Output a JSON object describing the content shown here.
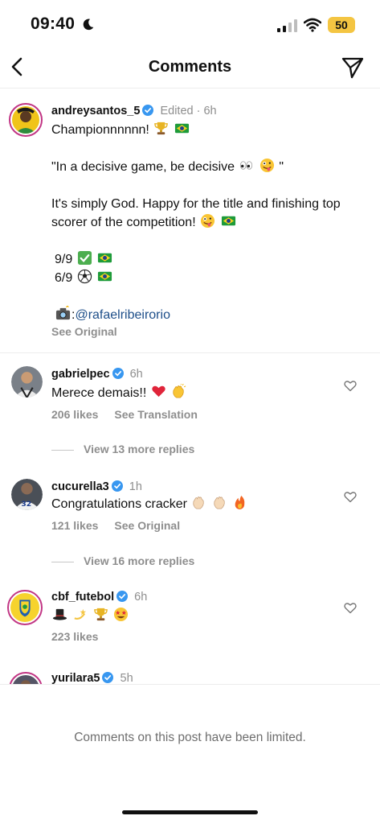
{
  "status_bar": {
    "time": "09:40",
    "battery": "50"
  },
  "header": {
    "title": "Comments"
  },
  "comments": [
    {
      "username": "andreysantos_5",
      "meta": "Edited · 6h",
      "lines": [
        "Championnnnnn!",
        "\"In a decisive game, be decisive",
        "\"",
        "It's simply God. Happy for the title and finishing top scorer of the competition!",
        "9/9",
        "6/9",
        ":",
        "@rafaelribeirorio"
      ],
      "action": "See Original"
    },
    {
      "username": "gabrielpec",
      "meta": "6h",
      "text": "Merece demais!!",
      "likes": "206 likes",
      "action": "See Translation",
      "replies": "View 13 more replies"
    },
    {
      "username": "cucurella3",
      "meta": "1h",
      "text": "Congratulations cracker",
      "likes": "121 likes",
      "action": "See Original",
      "replies": "View 16 more replies"
    },
    {
      "username": "cbf_futebol",
      "meta": "6h",
      "likes": "223 likes"
    },
    {
      "username": "yurilara5",
      "meta": "5h"
    }
  ],
  "footer": {
    "limited_text": "Comments on this post have been limited."
  }
}
